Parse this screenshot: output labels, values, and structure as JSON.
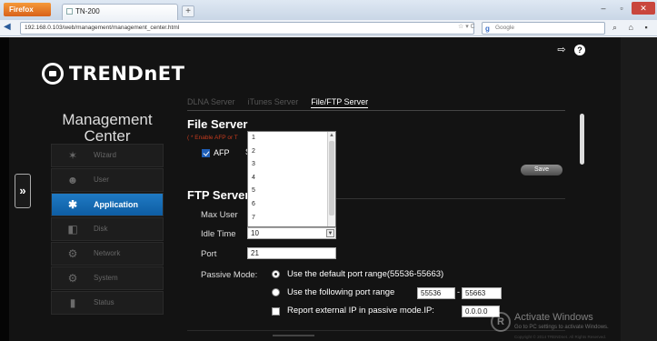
{
  "browser": {
    "app_button": "Firefox",
    "tab_title": "TN-200",
    "new_tab": "+",
    "url": "192.168.0.103/web/management/management_center.html",
    "url_icons": "☆ ▾ C",
    "search_engine": "Google",
    "search_placeholder": "Google",
    "nav_right_icons": "⌕ ⌂ ▪",
    "window_controls": {
      "minimize": "–",
      "maximize": "▫",
      "close": "✕"
    }
  },
  "top_icons": {
    "logout": "⇨",
    "help": "?"
  },
  "logo": {
    "text": "TRENDnET"
  },
  "expand_button": "»",
  "management_center": {
    "line1": "Management",
    "line2": "Center"
  },
  "sidebar": {
    "items": [
      {
        "label": "Wizard",
        "icon": "wand-icon",
        "glyph": "✶"
      },
      {
        "label": "User",
        "icon": "user-icon",
        "glyph": "☻"
      },
      {
        "label": "Application",
        "icon": "application-icon",
        "glyph": "✱"
      },
      {
        "label": "Disk",
        "icon": "disk-icon",
        "glyph": "◧"
      },
      {
        "label": "Network",
        "icon": "network-icon",
        "glyph": "⚙"
      },
      {
        "label": "System",
        "icon": "system-icon",
        "glyph": "⚙"
      },
      {
        "label": "Status",
        "icon": "status-icon",
        "glyph": "▮"
      }
    ],
    "active_index": 2
  },
  "tabs": [
    {
      "label": "DLNA Server",
      "active": false
    },
    {
      "label": "iTunes Server",
      "active": false
    },
    {
      "label": "File/FTP Server",
      "active": true
    }
  ],
  "file_server": {
    "title": "File Server",
    "note": "( * Enable AFP or T",
    "afp_label": "AFP",
    "afp_checked": true,
    "afp_extra": "S",
    "save_label": "Save"
  },
  "ftp_server": {
    "title": "FTP Server",
    "max_user_label": "Max User",
    "idle_time_label": "Idle Time",
    "idle_time_value": "10",
    "dropdown_options": [
      "1",
      "2",
      "3",
      "4",
      "5",
      "6",
      "7"
    ],
    "port_label": "Port",
    "port_value": "21",
    "passive_label": "Passive Mode:",
    "passive_default_text": "Use the default port range(55536-55663)",
    "passive_following_text": "Use the following port range",
    "passive_selected": "default",
    "range_from": "55536",
    "range_dash": "-",
    "range_to": "55663",
    "report_text": "Report external IP in passive mode.IP:",
    "report_checked": false,
    "report_ip": "0.0.0.0"
  },
  "watermark": {
    "title": "Activate Windows",
    "subtitle": "Go to PC settings to activate Windows.",
    "copyright": "Copyright © 2014 TRENDnet. All Rights Reserved."
  }
}
